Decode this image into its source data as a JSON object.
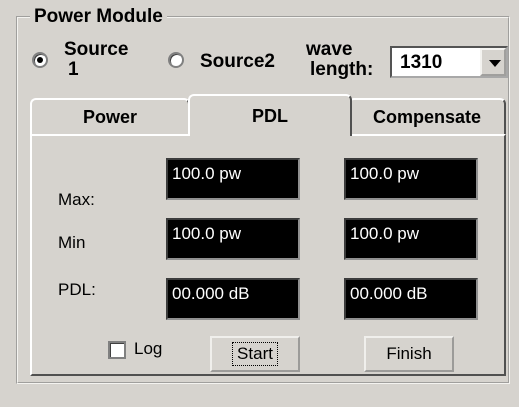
{
  "group": {
    "title": "Power Module"
  },
  "sources": {
    "source1": {
      "line1": "Source",
      "line2": "1",
      "checked": true
    },
    "source2": {
      "label": "Source2",
      "checked": false
    },
    "wavelength_label_line1": "wave",
    "wavelength_label_line2": "length:",
    "wavelength_value": "1310"
  },
  "tabs": [
    {
      "label": "Power",
      "active": false
    },
    {
      "label": "PDL",
      "active": true
    },
    {
      "label": "Compensate",
      "active": false
    }
  ],
  "pdl": {
    "rows": [
      {
        "label": "Max:",
        "col1": "100.0 pw",
        "col2": "100.0 pw"
      },
      {
        "label": "Min",
        "col1": "100.0 pw",
        "col2": "100.0 pw"
      },
      {
        "label": "PDL:",
        "col1": "00.000 dB",
        "col2": "00.000 dB"
      }
    ],
    "log_label": "Log",
    "log_checked": false,
    "start_label": "Start",
    "finish_label": "Finish"
  }
}
